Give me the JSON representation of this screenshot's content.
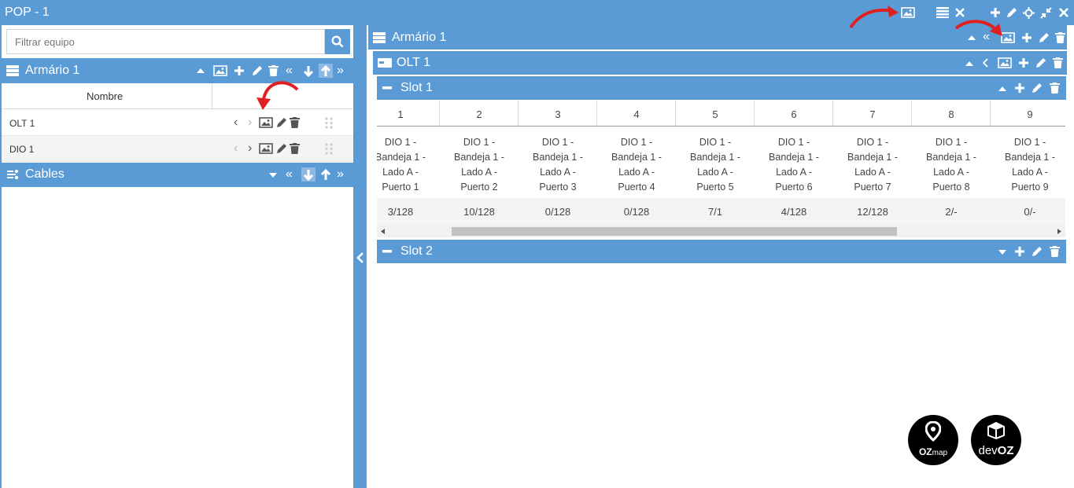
{
  "window": {
    "title": "POP - 1"
  },
  "left": {
    "search": {
      "placeholder": "Filtrar equipo"
    },
    "cabinet": {
      "title": "Armário 1"
    },
    "table": {
      "header": "Nombre",
      "rows": [
        {
          "name": "OLT 1"
        },
        {
          "name": "DIO 1"
        }
      ]
    },
    "cables": {
      "title": "Cables"
    }
  },
  "right": {
    "cabinet": {
      "title": "Armário 1"
    },
    "olt": {
      "title": "OLT 1"
    },
    "slot1": {
      "title": "Slot 1",
      "columns": [
        {
          "num": "1",
          "l1": "DIO 1 -",
          "l2": "Bandeja 1 -",
          "l3": "Lado A -",
          "l4": "Puerto 1",
          "count": "3/128"
        },
        {
          "num": "2",
          "l1": "DIO 1 -",
          "l2": "Bandeja 1 -",
          "l3": "Lado A -",
          "l4": "Puerto 2",
          "count": "10/128"
        },
        {
          "num": "3",
          "l1": "DIO 1 -",
          "l2": "Bandeja 1 -",
          "l3": "Lado A -",
          "l4": "Puerto 3",
          "count": "0/128"
        },
        {
          "num": "4",
          "l1": "DIO 1 -",
          "l2": "Bandeja 1 -",
          "l3": "Lado A -",
          "l4": "Puerto 4",
          "count": "0/128"
        },
        {
          "num": "5",
          "l1": "DIO 1 -",
          "l2": "Bandeja 1 -",
          "l3": "Lado A -",
          "l4": "Puerto 5",
          "count": "7/1"
        },
        {
          "num": "6",
          "l1": "DIO 1 -",
          "l2": "Bandeja 1 -",
          "l3": "Lado A -",
          "l4": "Puerto 6",
          "count": "4/128"
        },
        {
          "num": "7",
          "l1": "DIO 1 -",
          "l2": "Bandeja 1 -",
          "l3": "Lado A -",
          "l4": "Puerto 7",
          "count": "12/128"
        },
        {
          "num": "8",
          "l1": "DIO 1 -",
          "l2": "Bandeja 1 -",
          "l3": "Lado A -",
          "l4": "Puerto 8",
          "count": "2/-"
        },
        {
          "num": "9",
          "l1": "DIO 1 -",
          "l2": "Bandeja 1 -",
          "l3": "Lado A -",
          "l4": "Puerto 9",
          "count": "0/-"
        }
      ]
    },
    "slot2": {
      "title": "Slot 2"
    }
  },
  "logos": {
    "ozmap": {
      "a": "OZ",
      "b": "map"
    },
    "devoz": {
      "a": "dev",
      "b": "OZ"
    }
  },
  "icons": [
    "image-icon",
    "list-icon",
    "close-icon",
    "plus-icon",
    "pencil-icon",
    "move-icon",
    "collapse-icon",
    "trash-icon",
    "caret-up-icon",
    "caret-down-icon",
    "double-left-icon",
    "double-right-icon",
    "arrow-down-icon",
    "arrow-up-icon",
    "chevron-left-icon",
    "chevron-right-icon",
    "drag-handle-icon",
    "search-icon",
    "server-icon",
    "cable-icon",
    "minus-icon"
  ],
  "colors": {
    "header": "#5b9bd5",
    "annotation_arrow": "#e02020"
  }
}
